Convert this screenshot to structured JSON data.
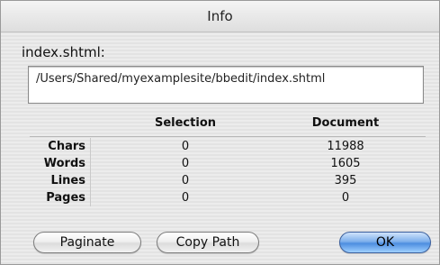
{
  "window": {
    "title": "Info"
  },
  "file": {
    "name": "index.shtml:",
    "path": "/Users/Shared/myexamplesite/bbedit/index.shtml"
  },
  "stats": {
    "headers": {
      "selection": "Selection",
      "document": "Document"
    },
    "rows": [
      {
        "label": "Chars",
        "selection": "0",
        "document": "11988"
      },
      {
        "label": "Words",
        "selection": "0",
        "document": "1605"
      },
      {
        "label": "Lines",
        "selection": "0",
        "document": "395"
      },
      {
        "label": "Pages",
        "selection": "0",
        "document": "0"
      }
    ]
  },
  "buttons": {
    "paginate": "Paginate",
    "copy_path": "Copy Path",
    "ok": "OK"
  }
}
